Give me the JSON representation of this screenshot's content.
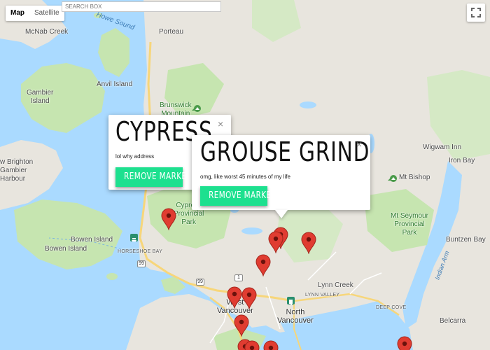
{
  "controls": {
    "map_label": "Map",
    "satellite_label": "Satellite",
    "search_placeholder": "SEARCH BOX"
  },
  "places": {
    "mcnab_creek": "McNab Creek",
    "porteau": "Porteau",
    "howe_sound": "Howe Sound",
    "anvil_island": "Anvil Island",
    "gambier_island": "Gambier\nIsland",
    "brunswick_mountain": "Brunswick\nMountain",
    "new_brighton": "w Brighton",
    "gambier_harbour": "Gambier\nHarbour",
    "cypress_park": "Cypress\nProvincial\nPark",
    "bowen_island_1": "Bowen Island",
    "bowen_island_2": "Bowen Island",
    "horseshoe_bay": "HORSESHOE BAY",
    "wigwam_inn": "Wigwam Inn",
    "iron_bay": "Iron Bay",
    "mt_bishop": "Mt Bishop",
    "mt_seymour_park": "Mt Seymour\nProvincial\nPark",
    "buntzen_bay": "Buntzen Bay",
    "indian_arm": "Indian Arm",
    "lynn_creek": "Lynn Creek",
    "lynn_valley": "LYNN VALLEY",
    "west_vancouver": "West\nVancouver",
    "north_vancouver": "North\nVancouver",
    "deep_cove": "DEEP COVE",
    "belcarra": "Belcarra",
    "highway_99a": "99",
    "highway_99b": "99",
    "highway_1": "1"
  },
  "popups": [
    {
      "title": "CYPRESS",
      "description": "lol why address",
      "button_label": "REMOVE MARKER",
      "close_symbol": "×"
    },
    {
      "title": "GROUSE GRIND",
      "description": "omg, like worst 45 minutes of my life",
      "button_label": "REMOVE MARKER",
      "close_symbol": "×"
    }
  ],
  "colors": {
    "water": "#aadaff",
    "land": "#e8e5de",
    "park": "#c6e5b0",
    "marker": "#e03c31",
    "button": "#1de08f",
    "highway": "#f7d67a"
  },
  "icons": {
    "fullscreen": "fullscreen-icon",
    "marker": "map-marker-icon",
    "peak": "mountain-peak-icon",
    "ferry": "ferry-terminal-icon",
    "train": "train-station-icon"
  }
}
